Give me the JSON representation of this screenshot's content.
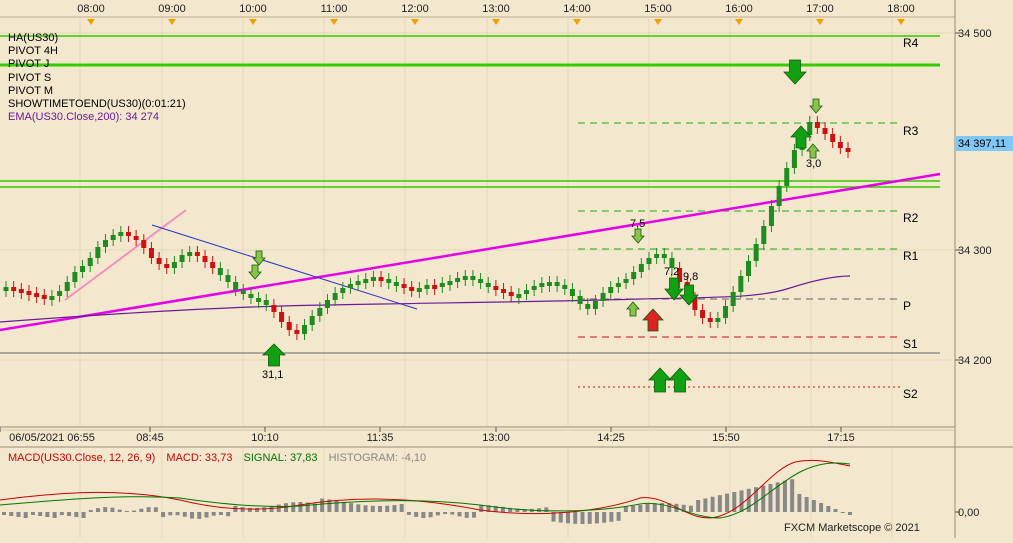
{
  "colors": {
    "background": "#f3e7cd",
    "pivot_green": "#33cc00",
    "ema": "#6a1b9a",
    "trend_magenta": "#e600e6",
    "up_candle": "#1e8c1e",
    "down_candle": "#cc1111",
    "macd_line": "#cc0000",
    "signal_line": "#007700",
    "histogram": "#888888",
    "price_highlight": "#7fc8f8",
    "time_marker": "#f0a000"
  },
  "top_time_axis": [
    "08:00",
    "09:00",
    "10:00",
    "11:00",
    "12:00",
    "13:00",
    "14:00",
    "15:00",
    "16:00",
    "17:00",
    "18:00"
  ],
  "bottom_time_axis": [
    "06/05/2021 06:55",
    "08:45",
    "10:10",
    "11:35",
    "13:00",
    "14:25",
    "15:50",
    "17:15"
  ],
  "price_axis": [
    "34 500",
    "34 300",
    "34 200"
  ],
  "current_price": "34 397,11",
  "pivot_labels": [
    "R4",
    "R3",
    "R2",
    "R1",
    "P",
    "S1",
    "S2"
  ],
  "legend": {
    "ha": "HA(US30)",
    "pivot_4h": "PIVOT 4H",
    "pivot_j": "PIVOT J",
    "pivot_s": "PIVOT S",
    "pivot_m": "PIVOT M",
    "showtime": "SHOWTIMETOEND(US30)(0:01:21)",
    "ema": "EMA(US30.Close,200): 34 274"
  },
  "macd_legend": {
    "name": "MACD(US30.Close, 12, 26, 9)",
    "macd": "MACD: 33,73",
    "signal": "SIGNAL: 37,83",
    "histogram": "HISTOGRAM: -4,10"
  },
  "macd_axis": [
    "0,00"
  ],
  "annotations": [
    "31,1",
    "7,5",
    "7,2",
    "9,8",
    "3,0"
  ],
  "copyright": "FXCM Marketscope © 2021"
}
